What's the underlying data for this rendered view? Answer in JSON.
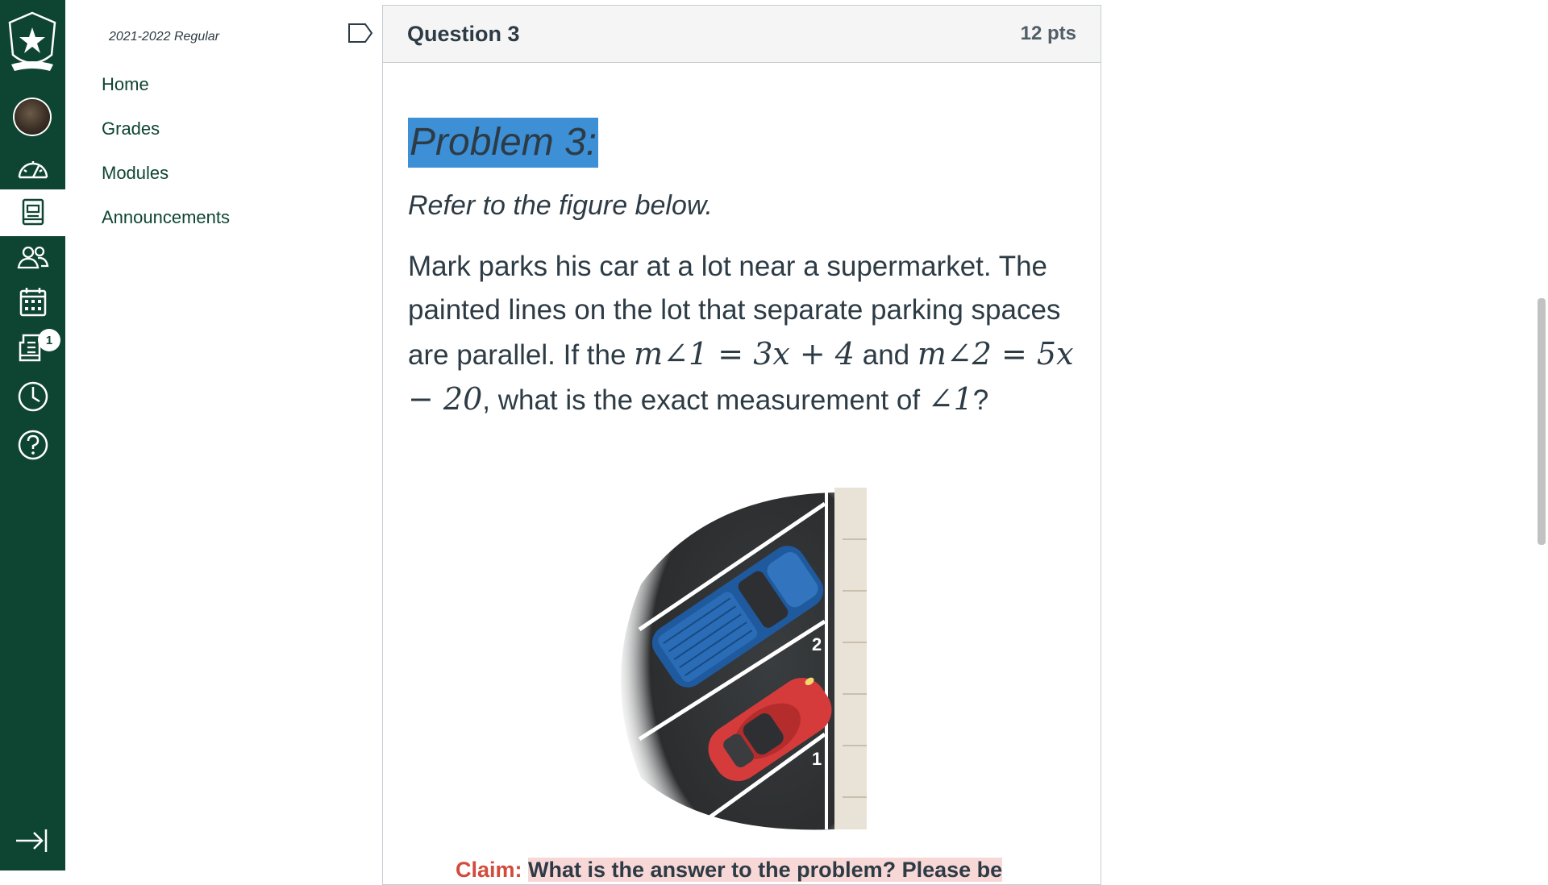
{
  "global_nav": {
    "badge_count": "1",
    "items": [
      {
        "icon": "account-avatar"
      },
      {
        "icon": "dashboard-icon"
      },
      {
        "icon": "courses-icon",
        "active": true
      },
      {
        "icon": "groups-icon"
      },
      {
        "icon": "calendar-icon"
      },
      {
        "icon": "inbox-icon"
      },
      {
        "icon": "history-icon"
      },
      {
        "icon": "help-icon"
      },
      {
        "icon": "collapse-nav-icon"
      }
    ]
  },
  "course_nav": {
    "term": "2021-2022 Regular",
    "links": [
      "Home",
      "Grades",
      "Modules",
      "Announcements"
    ]
  },
  "question": {
    "title": "Question 3",
    "points": "12 pts",
    "problem_title": "Problem 3:",
    "refer": "Refer to the figure below.",
    "text_1": "Mark parks his car at a lot near a supermarket. The painted lines on the lot that separate parking spaces are parallel. If the ",
    "math_1": "m∠1 = 3x + 4",
    "text_2": " and ",
    "math_2": "m∠2 = 5x − 20",
    "text_3": ", what is the exact measurement of ",
    "math_3": "∠1",
    "text_4": "?",
    "figure_labels": {
      "angle2": "2",
      "angle1": "1"
    },
    "claim_label": "Claim:",
    "claim_text": "What is the answer to the problem? Please be"
  },
  "colors": {
    "nav_bg": "#0e4532",
    "link": "#0e4532",
    "highlight": "#3d8fd6",
    "claim_label": "#d24b3c",
    "claim_bg": "#f8d7d7"
  }
}
